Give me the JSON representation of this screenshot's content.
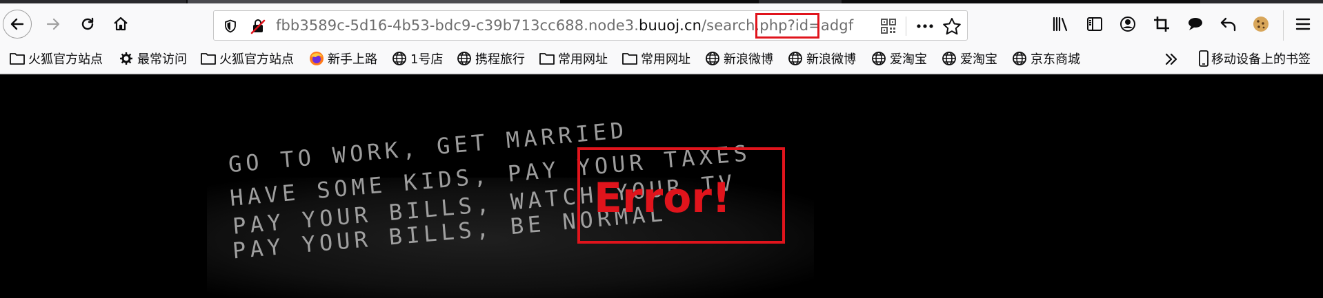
{
  "browser": {
    "url": {
      "prefix": "fbb3589c-5d16-4b53-bdc9-c39b713cc688.node3.",
      "host": "buuoj.cn",
      "path": "/search.php",
      "query": "?id=adgf"
    },
    "toolbar_icons": [
      "library-icon",
      "sidebar-icon",
      "account-icon",
      "screenshot-crop-icon",
      "chat-icon",
      "undo-icon",
      "cookie-icon",
      "menu-icon"
    ]
  },
  "bookmarks": {
    "items": [
      {
        "label": "火狐官方站点",
        "icon": "folder-icon"
      },
      {
        "label": "最常访问",
        "icon": "gear-icon"
      },
      {
        "label": "火狐官方站点",
        "icon": "folder-icon"
      },
      {
        "label": "新手上路",
        "icon": "firefox-icon"
      },
      {
        "label": "1号店",
        "icon": "globe-icon"
      },
      {
        "label": "携程旅行",
        "icon": "globe-icon"
      },
      {
        "label": "常用网址",
        "icon": "folder-icon"
      },
      {
        "label": "常用网址",
        "icon": "folder-icon"
      },
      {
        "label": "新浪微博",
        "icon": "globe-icon"
      },
      {
        "label": "新浪微博",
        "icon": "globe-icon"
      },
      {
        "label": "爱淘宝",
        "icon": "globe-icon"
      },
      {
        "label": "爱淘宝",
        "icon": "globe-icon"
      },
      {
        "label": "京东商城",
        "icon": "globe-icon"
      }
    ],
    "mobile_label": "移动设备上的书签"
  },
  "page": {
    "error_text": "Error!",
    "fabric_lines": [
      "GO TO WORK, GET MARRIED",
      "HAVE SOME KIDS, PAY YOUR TAXES",
      "PAY YOUR BILLS, WATCH YOUR TV",
      "PAY YOUR BILLS, BE NORMAL"
    ]
  }
}
